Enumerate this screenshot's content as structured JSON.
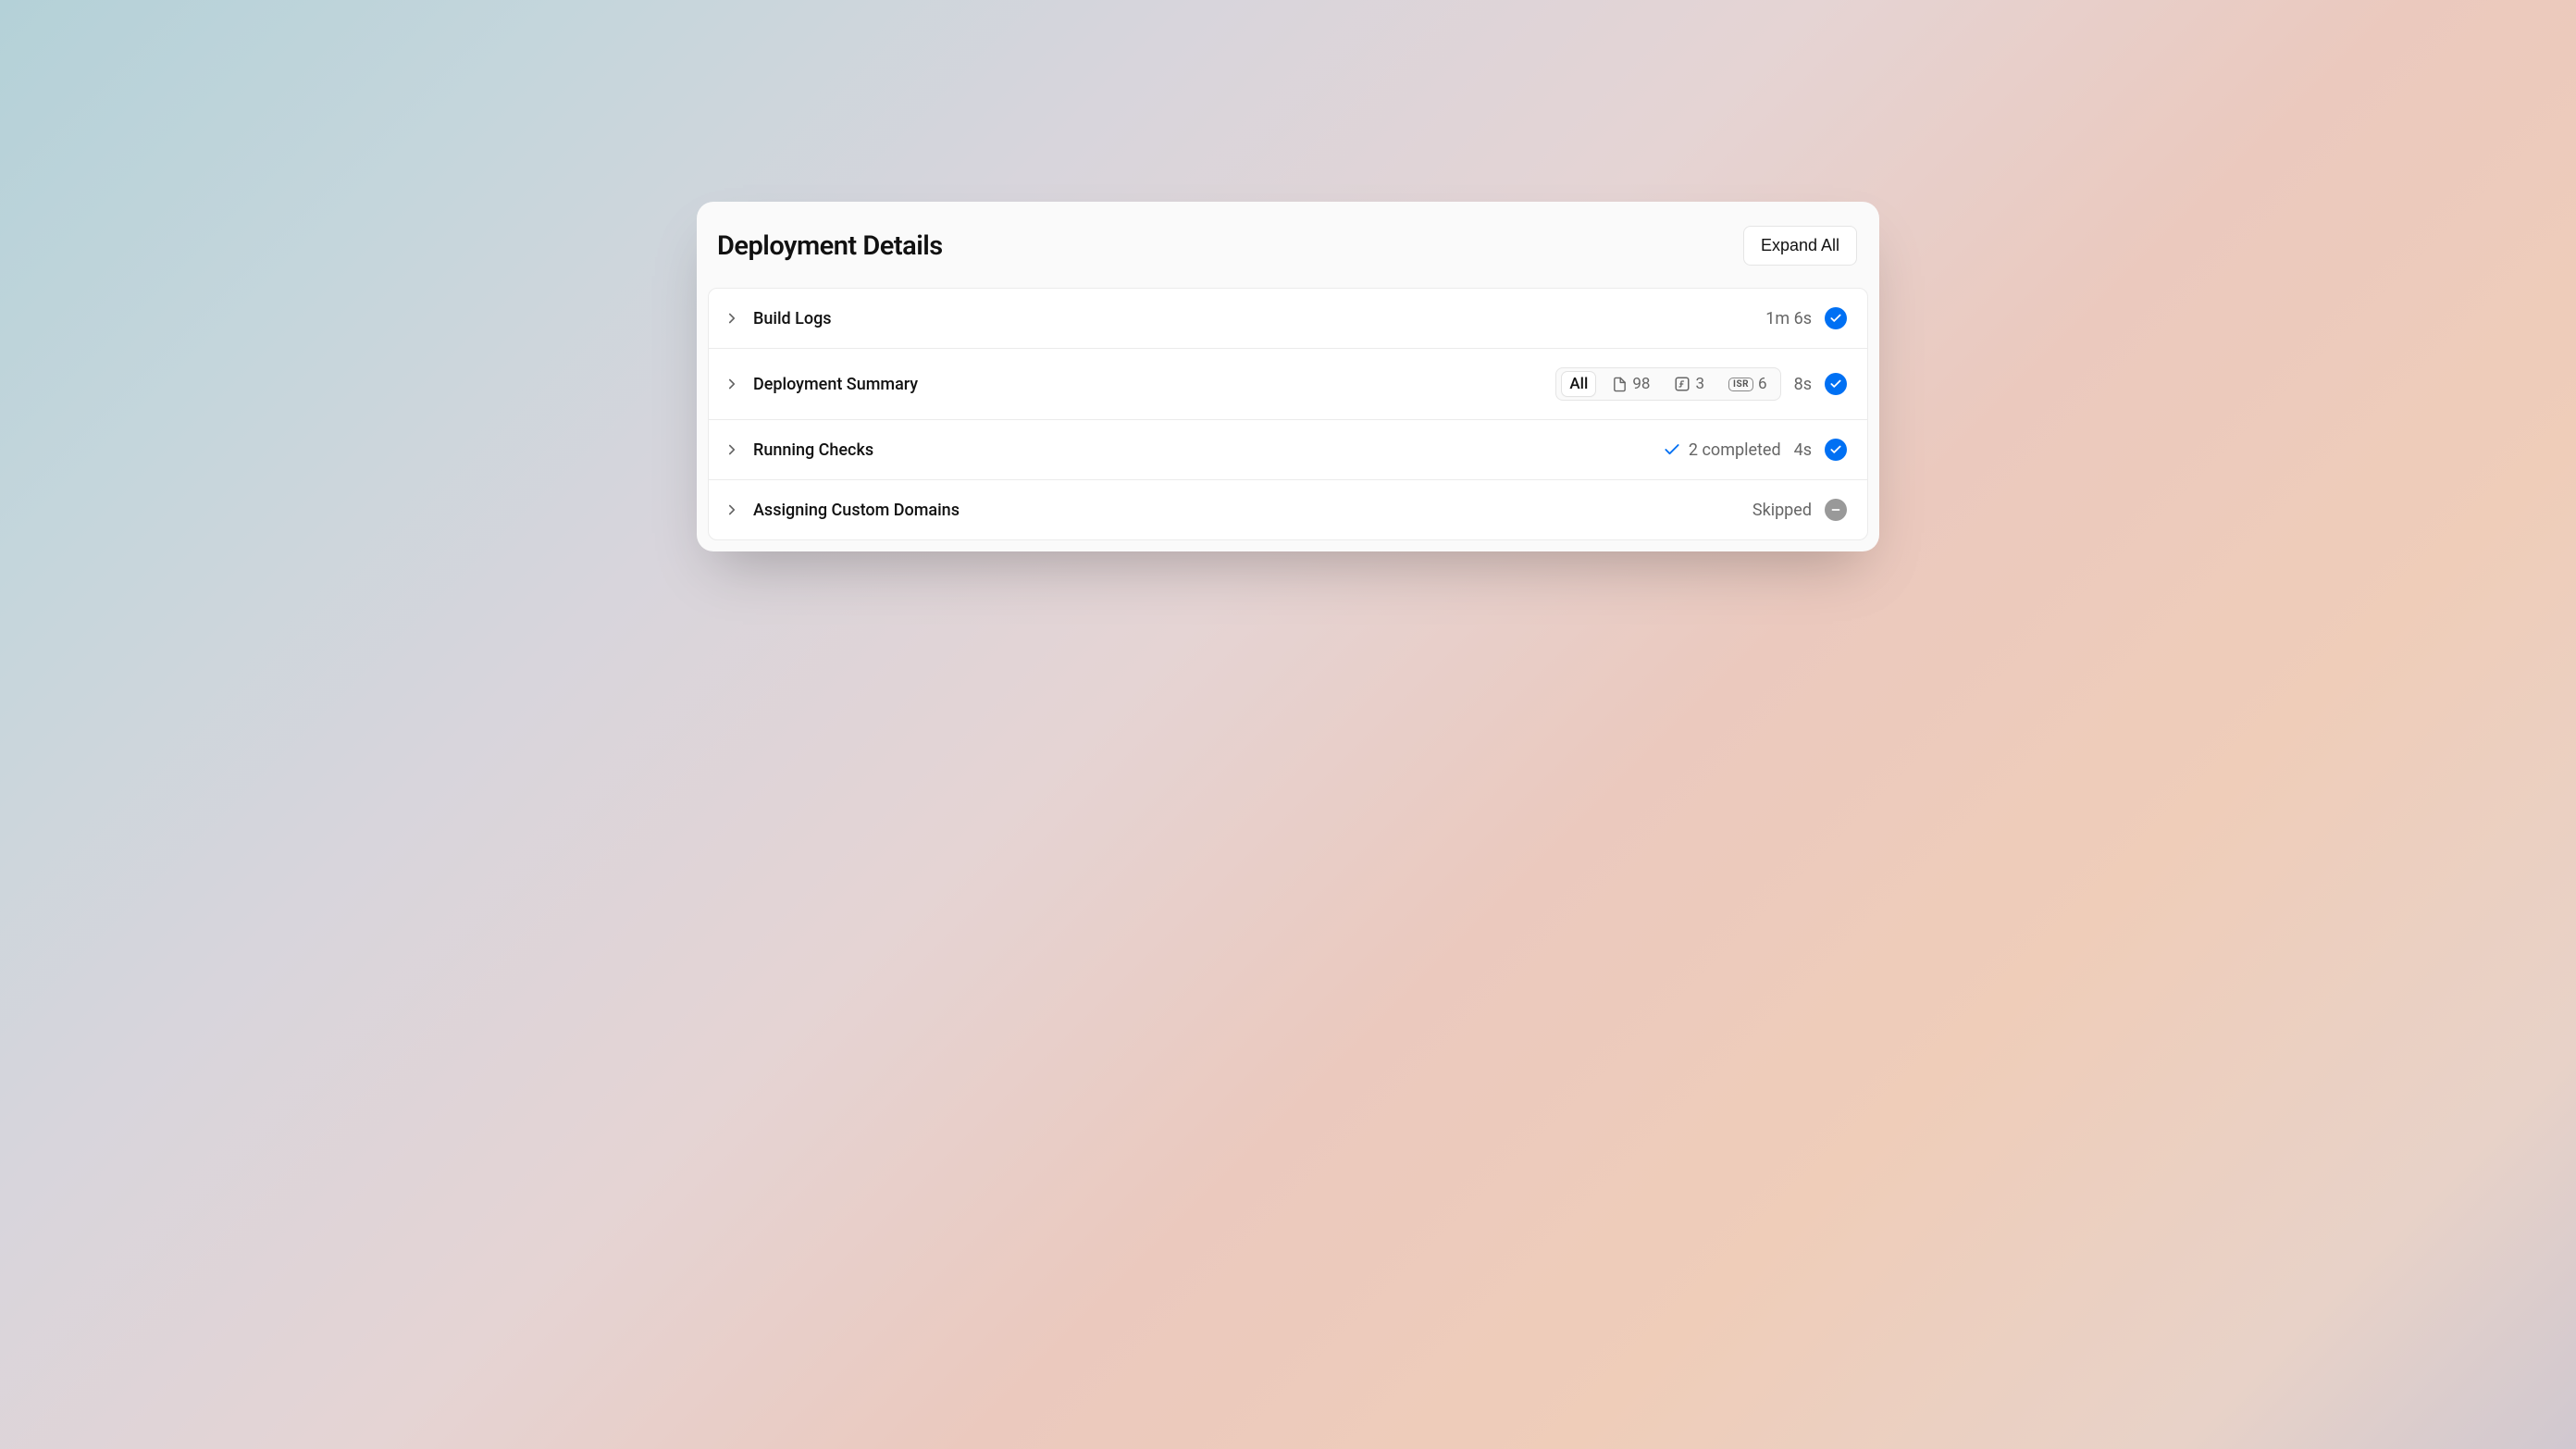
{
  "header": {
    "title": "Deployment Details",
    "expand_all": "Expand All"
  },
  "rows": [
    {
      "title": "Build Logs",
      "duration": "1m 6s",
      "status": "success"
    },
    {
      "title": "Deployment Summary",
      "duration": "8s",
      "status": "success",
      "filters": {
        "all": "All",
        "pages": "98",
        "functions": "3",
        "isr_label": "ISR",
        "isr": "6"
      }
    },
    {
      "title": "Running Checks",
      "completed": "2 completed",
      "duration": "4s",
      "status": "success"
    },
    {
      "title": "Assigning Custom Domains",
      "status_text": "Skipped",
      "status": "skipped"
    }
  ]
}
